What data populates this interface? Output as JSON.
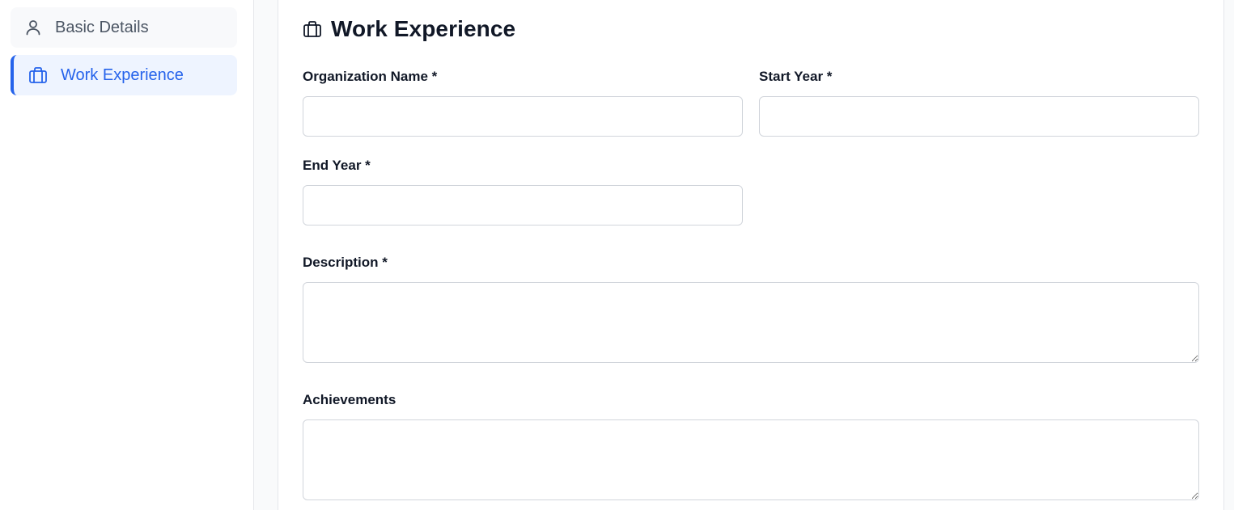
{
  "sidebar": {
    "items": [
      {
        "label": "Basic Details",
        "icon": "user-icon",
        "active": false
      },
      {
        "label": "Work Experience",
        "icon": "briefcase-icon",
        "active": true
      }
    ]
  },
  "section": {
    "title": "Work Experience",
    "icon": "briefcase-icon"
  },
  "form": {
    "organization": {
      "label": "Organization Name *",
      "value": "",
      "placeholder": ""
    },
    "start_year": {
      "label": "Start Year *",
      "value": "",
      "placeholder": ""
    },
    "end_year": {
      "label": "End Year *",
      "value": "",
      "placeholder": ""
    },
    "description": {
      "label": "Description *",
      "value": "",
      "placeholder": ""
    },
    "achievements": {
      "label": "Achievements",
      "value": "",
      "placeholder": ""
    }
  },
  "colors": {
    "accent": "#2563eb",
    "active_bg": "#eef4ff",
    "border": "#d1d5db"
  }
}
